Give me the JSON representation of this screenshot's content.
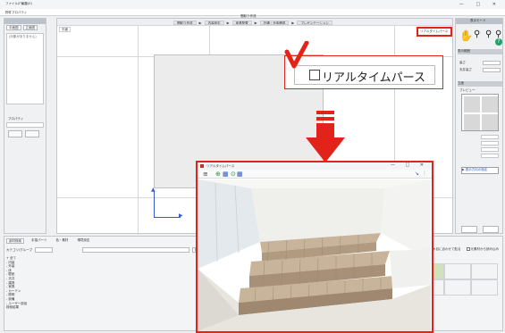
{
  "app": {
    "menu": [
      "ファイル(F)",
      "編集(E)"
    ],
    "label": "物件プロパティ",
    "window_controls": "— □ ✕"
  },
  "left_panel": {
    "tabs": [
      "平面図",
      "立面図"
    ],
    "list_text": "(対象がありません)",
    "prop_label": "プロパティ"
  },
  "top_toolbar": {
    "title": "間取り作成",
    "steps": [
      "間取り作成",
      "内装設定",
      "家具配置",
      "外構・全体確認",
      "プレゼンテーション"
    ]
  },
  "canvas": {
    "tab": "平面"
  },
  "realtime_toggle": {
    "small_label": "リアルタイムパース",
    "label": "リアルタイムパース",
    "checked": false
  },
  "right_panel": {
    "title": "表示モード",
    "sections": [
      "表示範囲",
      "立面"
    ],
    "height_label": "高さ",
    "floor_label": "天井高さ",
    "preview_label": "プレビュー",
    "option_button": "▶ 表示方向の指定"
  },
  "bottom_panel": {
    "tabs": [
      "部材検索",
      "手描パーツ",
      "色・素材",
      "環境設定"
    ],
    "filter_label": "カテゴリ/グループ",
    "search_label": "検索",
    "tree": [
      "+ 全て",
      " - 内装",
      " - 外装",
      " - 床",
      " - 壁紙",
      " - 天井",
      " - 建具",
      " - 家具",
      " - カーテン",
      " - 照明",
      " - 設備",
      " - ユーザー部品",
      "検索結果"
    ],
    "options": [
      "木目に合わせて貼る",
      "元素材から読み込み"
    ]
  },
  "realtime_window": {
    "title": "リアルタイムパース",
    "window_controls": "— □ ✕",
    "floor_color": "#e8e5df",
    "tile_color": "#c8b49a",
    "wall_color": "#f5f5f2"
  },
  "colors": {
    "accent": "#e2231a",
    "axis": "#3a5ad0",
    "help": "#22a06b"
  }
}
